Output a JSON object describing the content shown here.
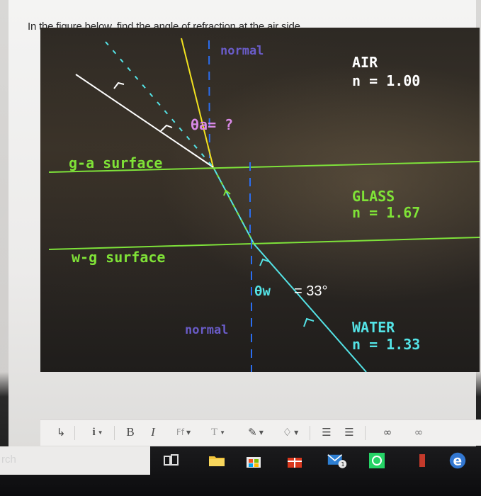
{
  "question": {
    "text": "In the figure below, find the angle of refraction at the air side."
  },
  "figure": {
    "normal_top_label": "normal",
    "normal_bottom_label": "normal",
    "air_label": "AIR",
    "air_index": "n = 1.00",
    "glass_label": "GLASS",
    "glass_index": "n = 1.67",
    "water_label": "WATER",
    "water_index": "n = 1.33",
    "ga_surface_label": "g-a surface",
    "wg_surface_label": "w-g surface",
    "theta_a_label": "θa= ?",
    "theta_w_symbol": "θw",
    "theta_w_value": "= 33°",
    "colors": {
      "surface_line": "#7ee23a",
      "normal_line": "#2b6ef0",
      "ray_water": "#54e3e6",
      "ray_air": "#ffffff",
      "refracted_ray": "#f2e21f",
      "label_green": "#7fe237",
      "label_white": "#ffffff",
      "label_pink": "#d889e6",
      "label_normal": "#6a5cc8"
    }
  },
  "editor_toolbar": {
    "items": [
      {
        "name": "indent-icon",
        "glyph": "↳"
      },
      {
        "name": "info-icon",
        "glyph": "i"
      },
      {
        "name": "bold-button",
        "glyph": "B"
      },
      {
        "name": "italic-button",
        "glyph": "I"
      },
      {
        "name": "font-family-button",
        "glyph": "Ff"
      },
      {
        "name": "font-size-button",
        "glyph": "T"
      },
      {
        "name": "paint-icon",
        "glyph": "✎"
      },
      {
        "name": "highlight-icon",
        "glyph": "♢"
      },
      {
        "name": "bullet-list-icon",
        "glyph": "☰"
      },
      {
        "name": "numbered-list-icon",
        "glyph": "☰"
      },
      {
        "name": "link-icon",
        "glyph": "∞"
      },
      {
        "name": "unlink-icon",
        "glyph": "∞"
      }
    ]
  },
  "taskbar": {
    "search_text": "rch",
    "mail_badge": "1"
  }
}
